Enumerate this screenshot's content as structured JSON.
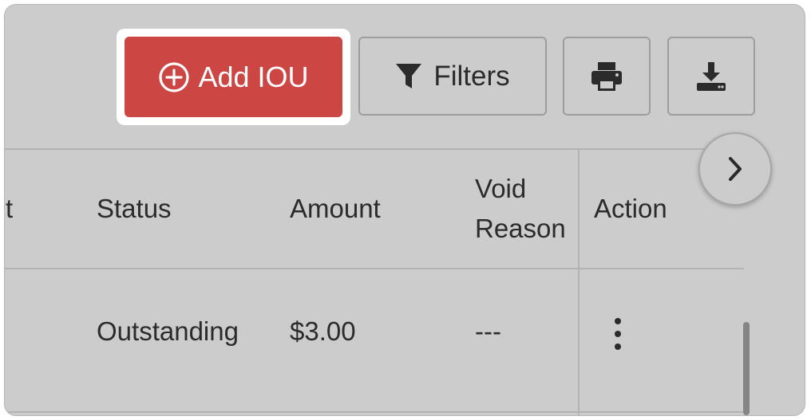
{
  "toolbar": {
    "add_label": "Add IOU",
    "filters_label": "Filters",
    "accent_color": "#cc4644"
  },
  "table": {
    "columns": {
      "partial": "t",
      "status": "Status",
      "amount": "Amount",
      "void_reason_line1": "Void",
      "void_reason_line2": "Reason",
      "action": "Action"
    },
    "rows": [
      {
        "status": "Outstanding",
        "amount": "$3.00",
        "void_reason": "---"
      }
    ]
  },
  "icons": {
    "add": "plus-circle-icon",
    "filters": "funnel-icon",
    "print": "printer-icon",
    "download": "download-icon",
    "action": "kebab-menu-icon",
    "scroll": "chevron-right-icon"
  }
}
